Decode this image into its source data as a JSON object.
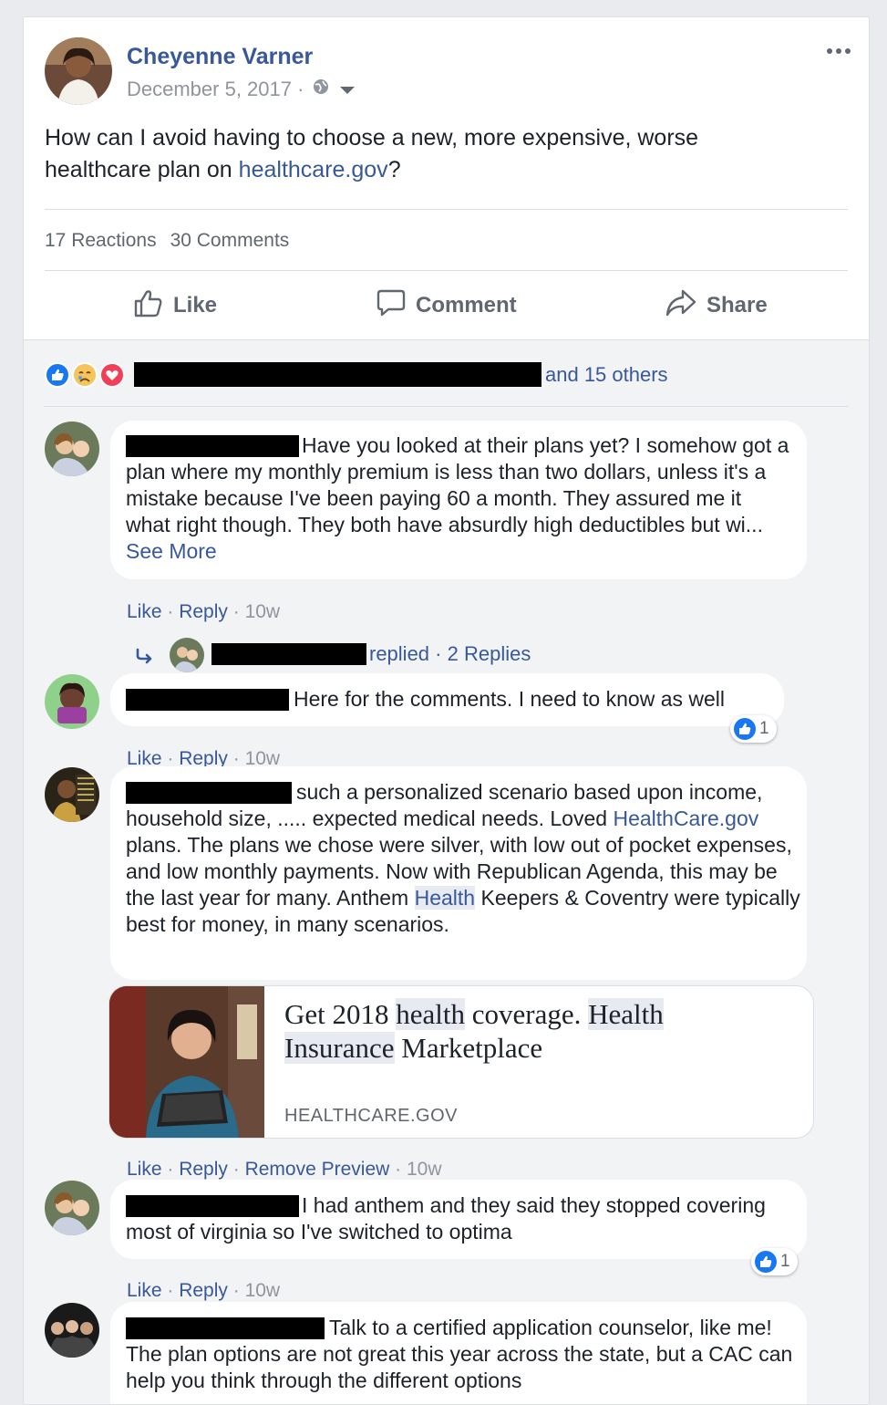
{
  "post": {
    "author": "Cheyenne Varner",
    "date": "December 5, 2017",
    "date_sep": " · ",
    "text_before": "How can I avoid having to choose a new, more expensive, worse healthcare plan on ",
    "text_link": "healthcare.gov",
    "text_after": "?",
    "reactions_count": "17 Reactions",
    "comments_count": "30 Comments"
  },
  "actions": {
    "like": "Like",
    "comment": "Comment",
    "share": "Share"
  },
  "reactions_summary": {
    "others": "and 15 others",
    "types": [
      "like",
      "sad",
      "love"
    ]
  },
  "comments": [
    {
      "text": "Have you looked at their plans yet? I somehow got a plan where my monthly premium is less than two dollars, unless it's a mistake because I've been paying 60 a month. They assured me it what right though. They both have absurdly high deductibles but wi...",
      "see_more": "See More",
      "like": "Like",
      "reply": "Reply",
      "time": "10w",
      "replies": {
        "replied": "replied",
        "count": "2 Replies"
      }
    },
    {
      "text": "Here for the comments. I need to know as well",
      "like": "Like",
      "reply": "Reply",
      "time": "10w",
      "reaction_count": "1"
    },
    {
      "text_1": "such a personalized scenario based upon income, household size, ..... expected medical needs. Loved ",
      "link_1": "HealthCare.gov",
      "text_2": " plans. The plans we chose were silver, with low out of pocket expenses, and low monthly payments. Now with Republican Agenda, this may be the last year for many. Anthem ",
      "highlight_1": "Health",
      "text_3": " Keepers & Coventry were typically best for money, in many scenarios.",
      "like": "Like",
      "reply": "Reply",
      "remove_preview": "Remove Preview",
      "time": "10w",
      "preview": {
        "title_1": "Get 2018 ",
        "title_hl_1": "health",
        "title_2": " coverage. ",
        "title_hl_2": "Health",
        "title_hl_3": "Insurance",
        "title_3": " Marketplace",
        "domain": "HEALTHCARE.GOV"
      }
    },
    {
      "text": "I had anthem and they said they stopped covering most of virginia so I've switched to optima",
      "like": "Like",
      "reply": "Reply",
      "time": "10w",
      "reaction_count": "1"
    },
    {
      "text": "Talk to a certified application counselor, like me! The plan options are not great this year across the state, but a CAC can help you think through the different options"
    }
  ],
  "meta_sep": " · ",
  "colors": {
    "link": "#385898",
    "meta": "#90949c",
    "like_blue": "#1877f2",
    "love_red": "#f33e58",
    "sad_yellow": "#f7c35c"
  }
}
